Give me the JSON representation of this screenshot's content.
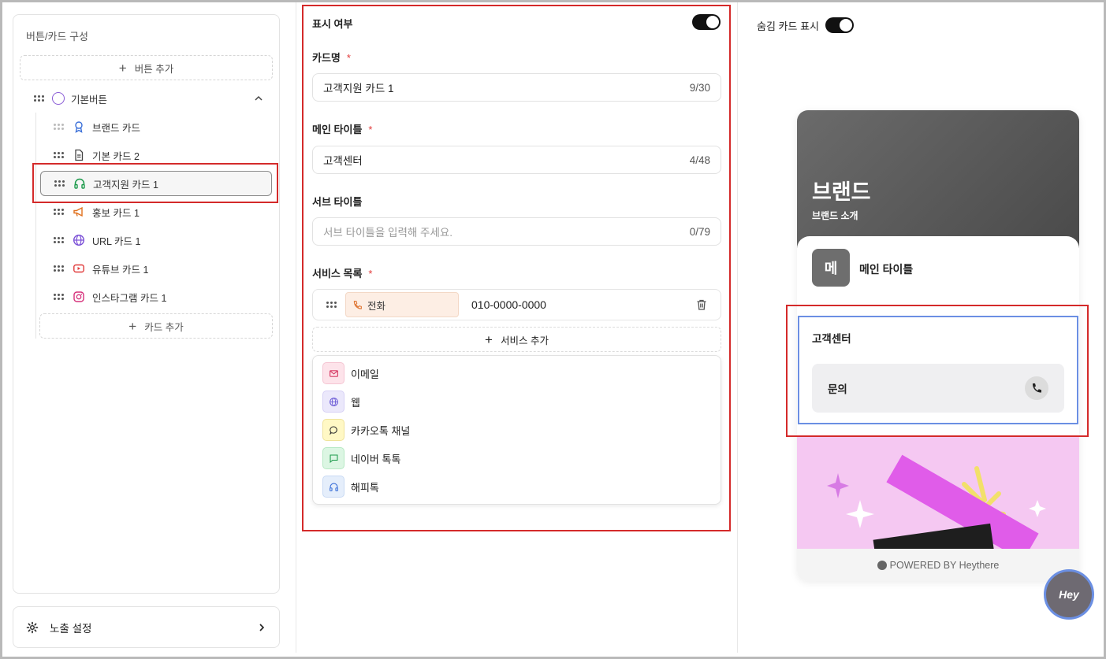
{
  "left": {
    "title": "버튼/카드 구성",
    "add_button": "버튼 추가",
    "root_item": "기본버튼",
    "items": [
      {
        "label": "브랜드 카드",
        "icon": "award-icon"
      },
      {
        "label": "기본 카드 2",
        "icon": "document-icon"
      },
      {
        "label": "고객지원 카드 1",
        "icon": "headphones-icon"
      },
      {
        "label": "홍보 카드 1",
        "icon": "megaphone-icon"
      },
      {
        "label": "URL 카드 1",
        "icon": "globe-icon"
      },
      {
        "label": "유튜브 카드 1",
        "icon": "youtube-icon"
      },
      {
        "label": "인스타그램 카드 1",
        "icon": "instagram-icon"
      }
    ],
    "add_card": "카드 추가",
    "expose_settings": "노출 설정"
  },
  "editor": {
    "visibility_label": "표시 여부",
    "visibility_on": true,
    "card_name_label": "카드명",
    "card_name_value": "고객지원 카드 1",
    "card_name_count": "9/30",
    "main_title_label": "메인 타이틀",
    "main_title_value": "고객센터",
    "main_title_count": "4/48",
    "sub_title_label": "서브 타이틀",
    "sub_title_placeholder": "서브 타이틀을 입력해 주세요.",
    "sub_title_count": "0/79",
    "service_list_label": "서비스 목록",
    "required_mark": "*",
    "service_item": {
      "type": "전화",
      "value": "010-0000-0000"
    },
    "add_service": "서비스 추가",
    "service_options": [
      {
        "label": "이메일",
        "icon": "mail-icon",
        "color": "#fde3ea"
      },
      {
        "label": "웹",
        "icon": "globe-icon",
        "color": "#ebe8fb"
      },
      {
        "label": "카카오톡 채널",
        "icon": "chat-bubble-icon",
        "color": "#fff8c5"
      },
      {
        "label": "네이버 톡톡",
        "icon": "message-square-icon",
        "color": "#dcf6e3"
      },
      {
        "label": "해피톡",
        "icon": "headphones-icon",
        "color": "#e5eefb"
      }
    ]
  },
  "preview": {
    "hidden_cards_label": "숨김 카드 표시",
    "hidden_cards_on": true,
    "brand_title": "브랜드",
    "brand_subtitle": "브랜드 소개",
    "avatar_letter": "메",
    "main_title": "메인 타이틀",
    "cs_title": "고객센터",
    "cs_button": "문의",
    "powered_by": "POWERED BY Heythere",
    "hey_button": "Hey"
  }
}
